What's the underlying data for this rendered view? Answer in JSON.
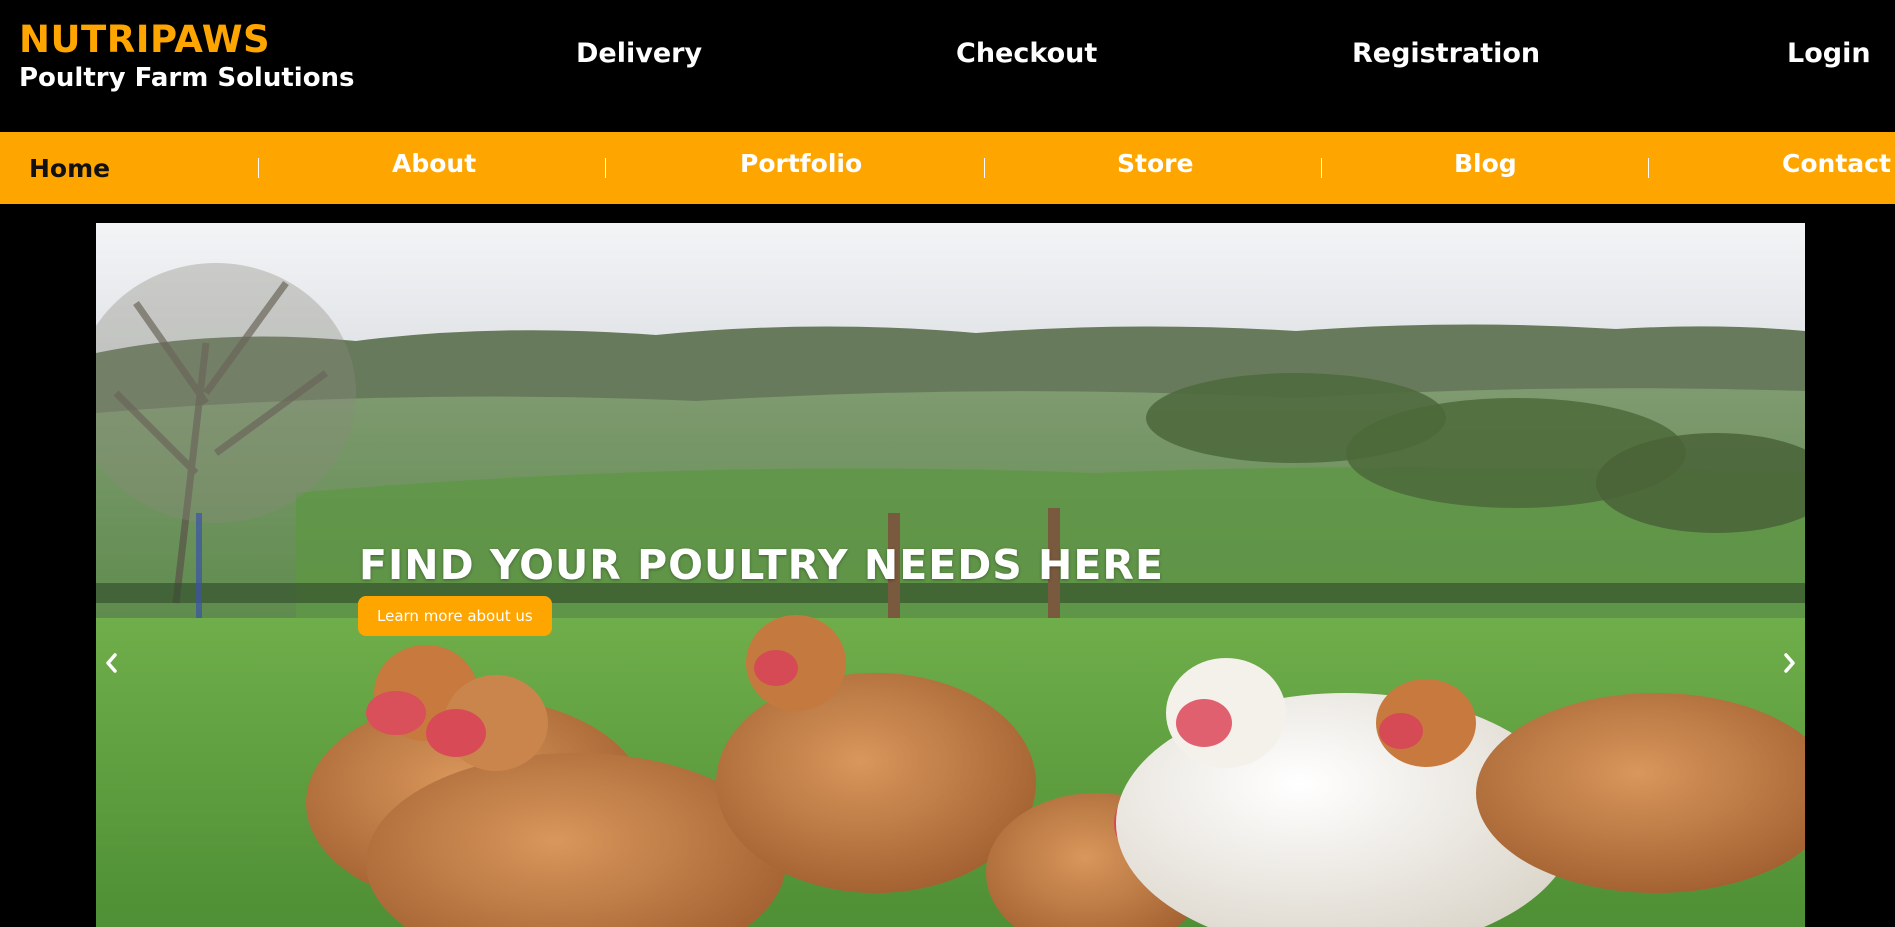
{
  "brand": {
    "name": "NUTRIPAWS",
    "tagline": "Poultry Farm Solutions"
  },
  "top_nav": {
    "delivery": "Delivery",
    "checkout": "Checkout",
    "registration": "Registration",
    "login": "Login"
  },
  "main_nav": {
    "home": "Home",
    "about": "About",
    "portfolio": "Portfolio",
    "store": "Store",
    "blog": "Blog",
    "contact": "Contact",
    "active": "Home"
  },
  "hero": {
    "title": "FIND YOUR POULTRY NEEDS HERE",
    "button_label": "Learn more about us",
    "prev_icon": "chevron-left-icon",
    "next_icon": "chevron-right-icon"
  },
  "colors": {
    "accent": "#FFA500",
    "header_bg": "#000000",
    "text_light": "#FFFFFF",
    "active_nav_text": "#111111"
  }
}
